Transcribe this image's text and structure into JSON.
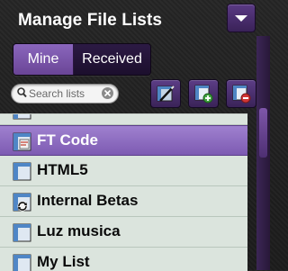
{
  "header": {
    "title": "Manage File Lists",
    "menu_icon": "triangle-down-icon"
  },
  "tabs": [
    {
      "label": "Mine",
      "active": true
    },
    {
      "label": "Received",
      "active": false
    }
  ],
  "search": {
    "placeholder": "Search lists",
    "value": ""
  },
  "actions": [
    {
      "name": "edit-list",
      "icon": "list-edit-icon"
    },
    {
      "name": "add-list",
      "icon": "list-add-icon"
    },
    {
      "name": "remove-list",
      "icon": "list-remove-icon"
    }
  ],
  "list": {
    "items": [
      {
        "label": "FT Code",
        "selected": true,
        "icon": "list-doc-icon"
      },
      {
        "label": "HTML5",
        "selected": false,
        "icon": "list-doc-icon"
      },
      {
        "label": "Internal Betas",
        "selected": false,
        "icon": "list-sync-icon"
      },
      {
        "label": "Luz musica",
        "selected": false,
        "icon": "list-doc-icon"
      },
      {
        "label": "My List",
        "selected": false,
        "icon": "list-doc-icon"
      }
    ]
  },
  "colors": {
    "accent": "#7d5ab2",
    "selected_row": "#8e6cc2",
    "list_background": "#dbe4dd",
    "header_background": "#222222"
  }
}
